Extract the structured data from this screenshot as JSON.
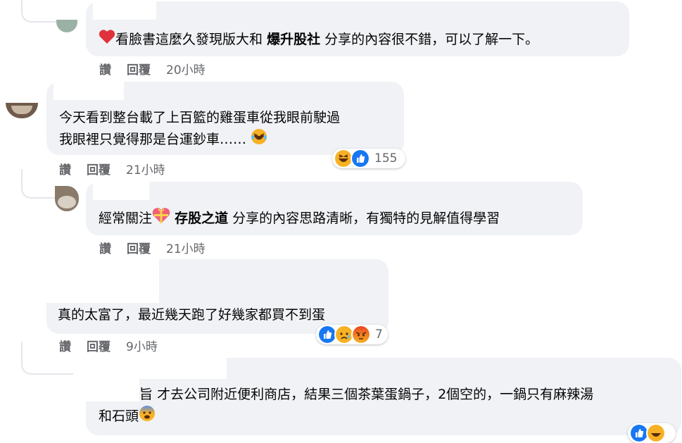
{
  "comments": [
    {
      "text_before": "看臉書這麼久發現版大和",
      "mention": "爆升股社",
      "text_after": "分享的內容很不錯，可以了解一下。",
      "actions": {
        "like": "讚",
        "reply": "回覆",
        "time": "20小時"
      }
    },
    {
      "line1": "今天看到整台載了上百籃的雞蛋車從我眼前駛過",
      "line2": "我眼裡只覺得那是台運鈔車……",
      "actions": {
        "like": "讚",
        "reply": "回覆",
        "time": "21小時"
      },
      "reactions": {
        "icons": [
          "laugh",
          "like"
        ],
        "count": "155"
      }
    },
    {
      "text_before": "經常關注",
      "mention": "存股之道",
      "text_after": "分享的內容思路清晰，有獨特的見解值得學習",
      "actions": {
        "like": "讚",
        "reply": "回覆",
        "time": "21小時"
      }
    },
    {
      "text": "真的太富了，最近幾天跑了好幾家都買不到蛋",
      "actions": {
        "like": "讚",
        "reply": "回覆",
        "time": "9小時"
      },
      "reactions": {
        "icons": [
          "like",
          "sad",
          "angry"
        ],
        "count": "7"
      }
    },
    {
      "partial_name": "旨",
      "line1": "才去公司附近便利商店，結果三個茶葉蛋鍋子，2個空的，一鍋只有麻辣湯",
      "line2": "和石頭"
    }
  ],
  "colors": {
    "bubble": "#f0f2f5",
    "meta_text": "#65676b",
    "like_blue": "#1877f2",
    "emoji_yellow": "#f7b125",
    "angry_red": "#e9710f",
    "heart_red": "#f33e58"
  }
}
